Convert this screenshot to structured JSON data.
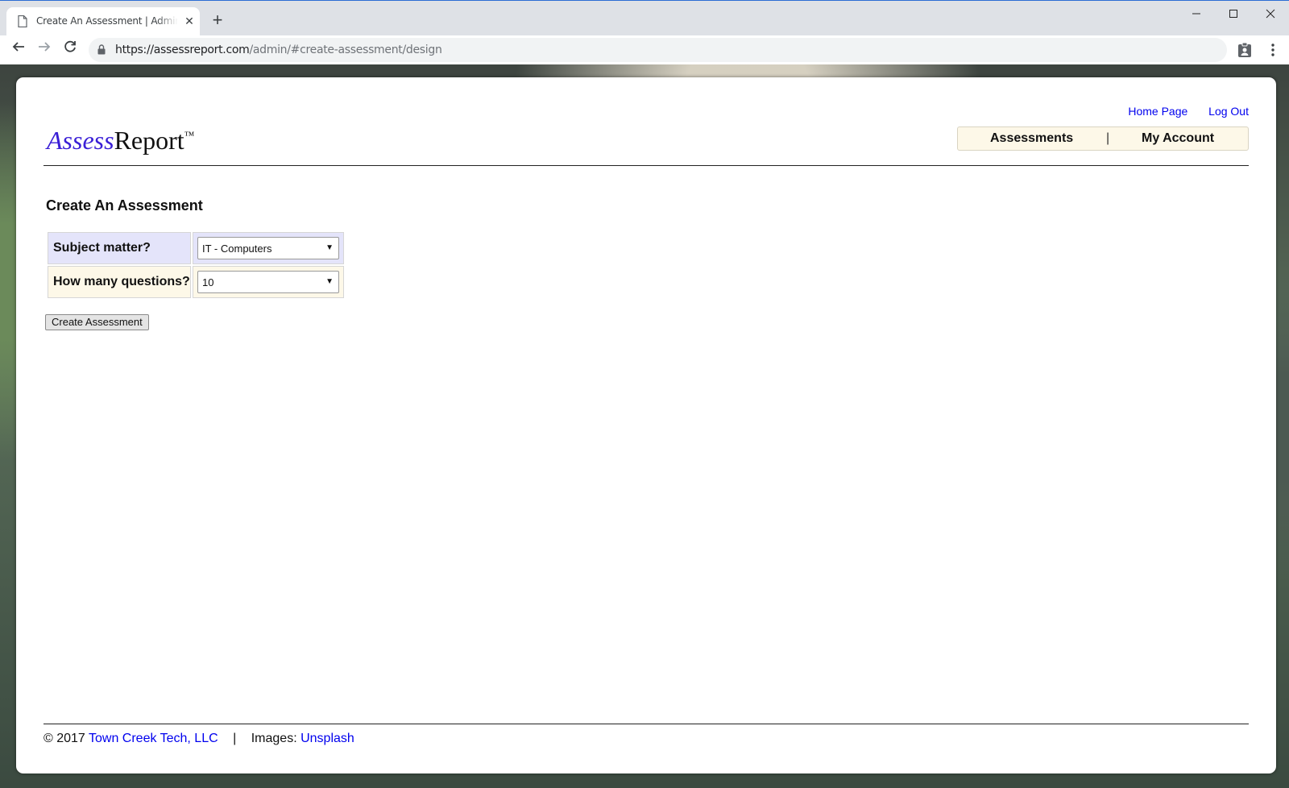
{
  "browser": {
    "tab_title": "Create An Assessment | Admin Page",
    "new_tab_symbol": "+",
    "url_host": "https://assessreport.com",
    "url_path": "/admin/#create-assessment/design",
    "window_controls": {
      "minimize": "—",
      "maximize": "☐",
      "close": "✕"
    },
    "icons": [
      "page-icon",
      "close-icon",
      "back-arrow-icon",
      "forward-arrow-icon",
      "reload-icon",
      "lock-icon",
      "extension-icon",
      "kebab-menu-icon"
    ]
  },
  "header": {
    "top_links": [
      "Home Page",
      "Log Out"
    ],
    "logo_part1": "Assess",
    "logo_part2": "Report",
    "logo_tm": "™",
    "nav": {
      "assessments": "Assessments",
      "separator": "|",
      "my_account": "My Account"
    }
  },
  "main": {
    "title": "Create An Assessment",
    "fields": [
      {
        "label": "Subject matter?",
        "value": "IT - Computers"
      },
      {
        "label": "How many questions?",
        "value": "10"
      }
    ],
    "submit_label": "Create Assessment"
  },
  "footer": {
    "copyright": "© 2017",
    "company_link": "Town Creek Tech, LLC",
    "separator": "|",
    "images_label": "Images:",
    "images_link": "Unsplash"
  },
  "colors": {
    "link": "#0000ee",
    "logo_accent": "#3a1fd6",
    "field_row1_bg": "#e4e4fa",
    "field_row2_bg": "#fdf8e8"
  }
}
